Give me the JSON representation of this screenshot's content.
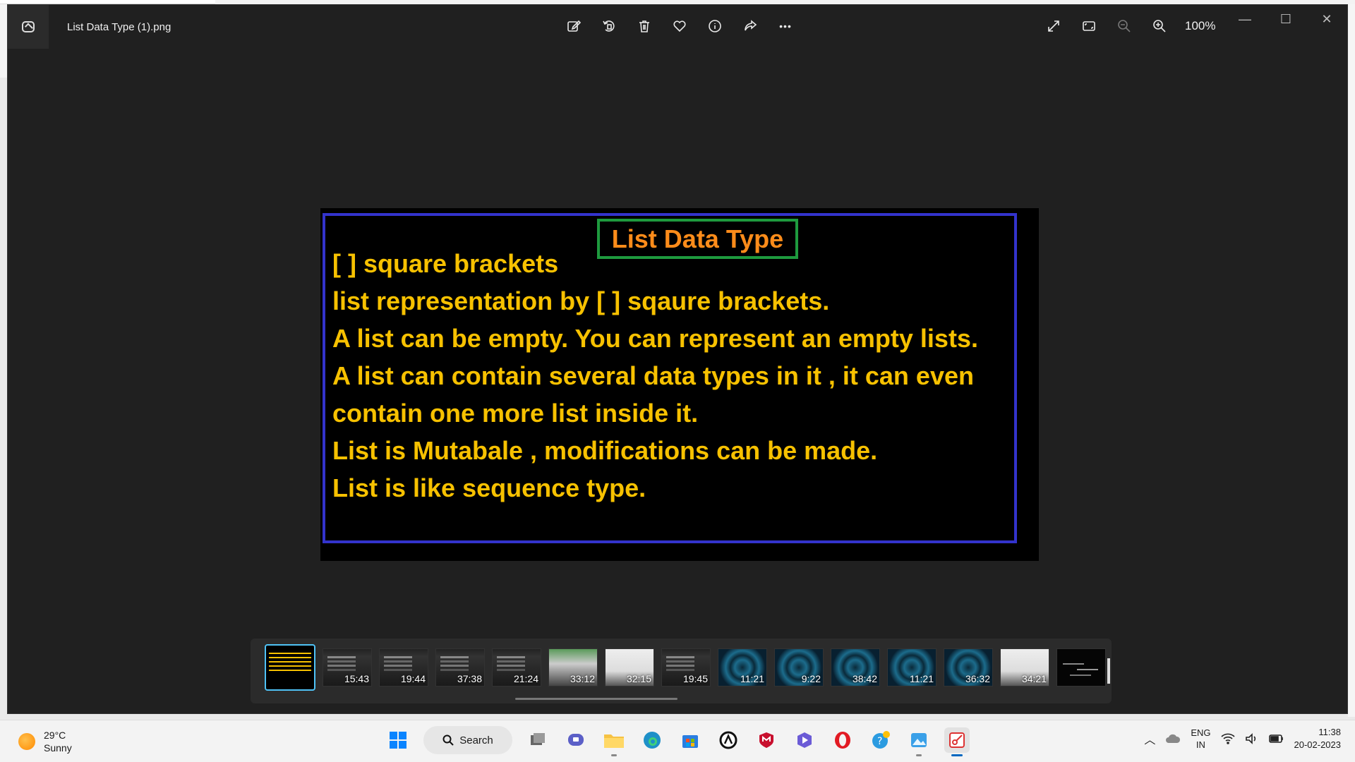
{
  "window": {
    "title": "List Data Type (1).png",
    "zoom": "100%"
  },
  "toolbar": {
    "icons": [
      "edit-icon",
      "rotate-icon",
      "delete-icon",
      "favorite-icon",
      "info-icon",
      "share-icon",
      "more-icon"
    ],
    "more_label": "•••"
  },
  "view_tools": {
    "icons": [
      "fullscreen-icon",
      "fit-window-icon",
      "zoom-out-icon",
      "zoom-in-icon"
    ]
  },
  "win_controls": {
    "minimize": "—",
    "maximize": "☐",
    "close": "✕"
  },
  "slide": {
    "title": "List Data Type",
    "lines": [
      "[  ]  square brackets",
      "list representation by [ ] sqaure brackets.",
      "A list can be empty. You can represent an empty lists.",
      "A list can contain several data types in it , it can even",
      "contain one more list inside it.",
      "List is Mutabale , modifications can be made.",
      "List is like sequence type."
    ],
    "colors": {
      "text": "#f7c100",
      "title": "#ff8c1a",
      "title_border": "#1e9a3e",
      "frame": "#3333cc"
    }
  },
  "filmstrip": {
    "durations": [
      "",
      "15:43",
      "19:44",
      "37:38",
      "21:24",
      "33:12",
      "32:15",
      "19:45",
      "11:21",
      "9:22",
      "38:42",
      "11:21",
      "36:32",
      "34:21",
      ""
    ]
  },
  "taskbar": {
    "weather_temp": "29°C",
    "weather_desc": "Sunny",
    "search_label": "Search",
    "lang_line1": "ENG",
    "lang_line2": "IN",
    "time": "11:38",
    "date": "20-02-2023"
  }
}
